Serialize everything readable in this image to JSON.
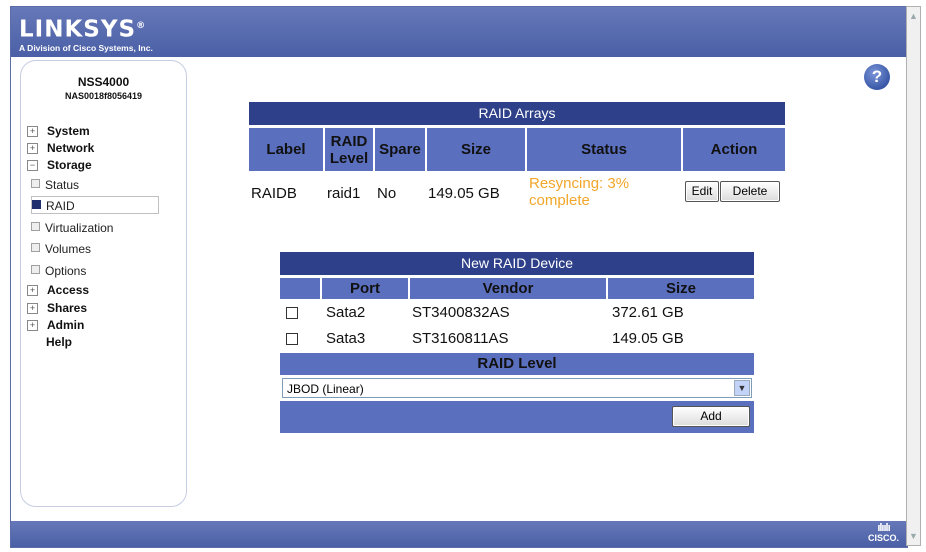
{
  "header": {
    "brand": "LINKSYS",
    "brand_mark": "®",
    "subtitle": "A Division of Cisco Systems, Inc."
  },
  "footer": {
    "cisco_bars": "ılıılı",
    "cisco_label": "CISCO."
  },
  "help_icon": "?",
  "sidebar": {
    "device_name": "NSS4000",
    "device_id": "NAS0018f8056419",
    "items": [
      {
        "label": "System",
        "expander": "+"
      },
      {
        "label": "Network",
        "expander": "+"
      },
      {
        "label": "Storage",
        "expander": "−"
      }
    ],
    "storage_subitems": [
      {
        "label": "Status",
        "active": false
      },
      {
        "label": "RAID",
        "active": true
      },
      {
        "label": "Virtualization",
        "active": false
      },
      {
        "label": "Volumes",
        "active": false
      },
      {
        "label": "Options",
        "active": false
      }
    ],
    "items_after": [
      {
        "label": "Access",
        "expander": "+"
      },
      {
        "label": "Shares",
        "expander": "+"
      },
      {
        "label": "Admin",
        "expander": "+"
      }
    ],
    "help": "Help"
  },
  "raid_arrays": {
    "title": "RAID Arrays",
    "columns": [
      "Label",
      "RAID Level",
      "Spare",
      "Size",
      "Status",
      "Action"
    ],
    "rows": [
      {
        "label": "RAIDB",
        "level": "raid1",
        "spare": "No",
        "size": "149.05 GB",
        "status": "Resyncing: 3% complete",
        "edit": "Edit",
        "delete": "Delete"
      }
    ]
  },
  "new_raid": {
    "title": "New RAID Device",
    "columns": [
      "",
      "Port",
      "Vendor",
      "Size"
    ],
    "rows": [
      {
        "port": "Sata2",
        "vendor": "ST3400832AS",
        "size": "372.61 GB"
      },
      {
        "port": "Sata3",
        "vendor": "ST3160811AS",
        "size": "149.05 GB"
      }
    ],
    "raid_level_label": "RAID Level",
    "raid_level_value": "JBOD (Linear)",
    "add_label": "Add"
  },
  "colors": {
    "header": "#4a5fa6",
    "table_header": "#5b6fbf",
    "title_bar": "#2e4089",
    "status_warning": "#f2a62a"
  },
  "icons": [
    "help-icon",
    "dropdown-arrow-icon",
    "scroll-up-icon",
    "scroll-down-icon",
    "cisco-logo"
  ]
}
